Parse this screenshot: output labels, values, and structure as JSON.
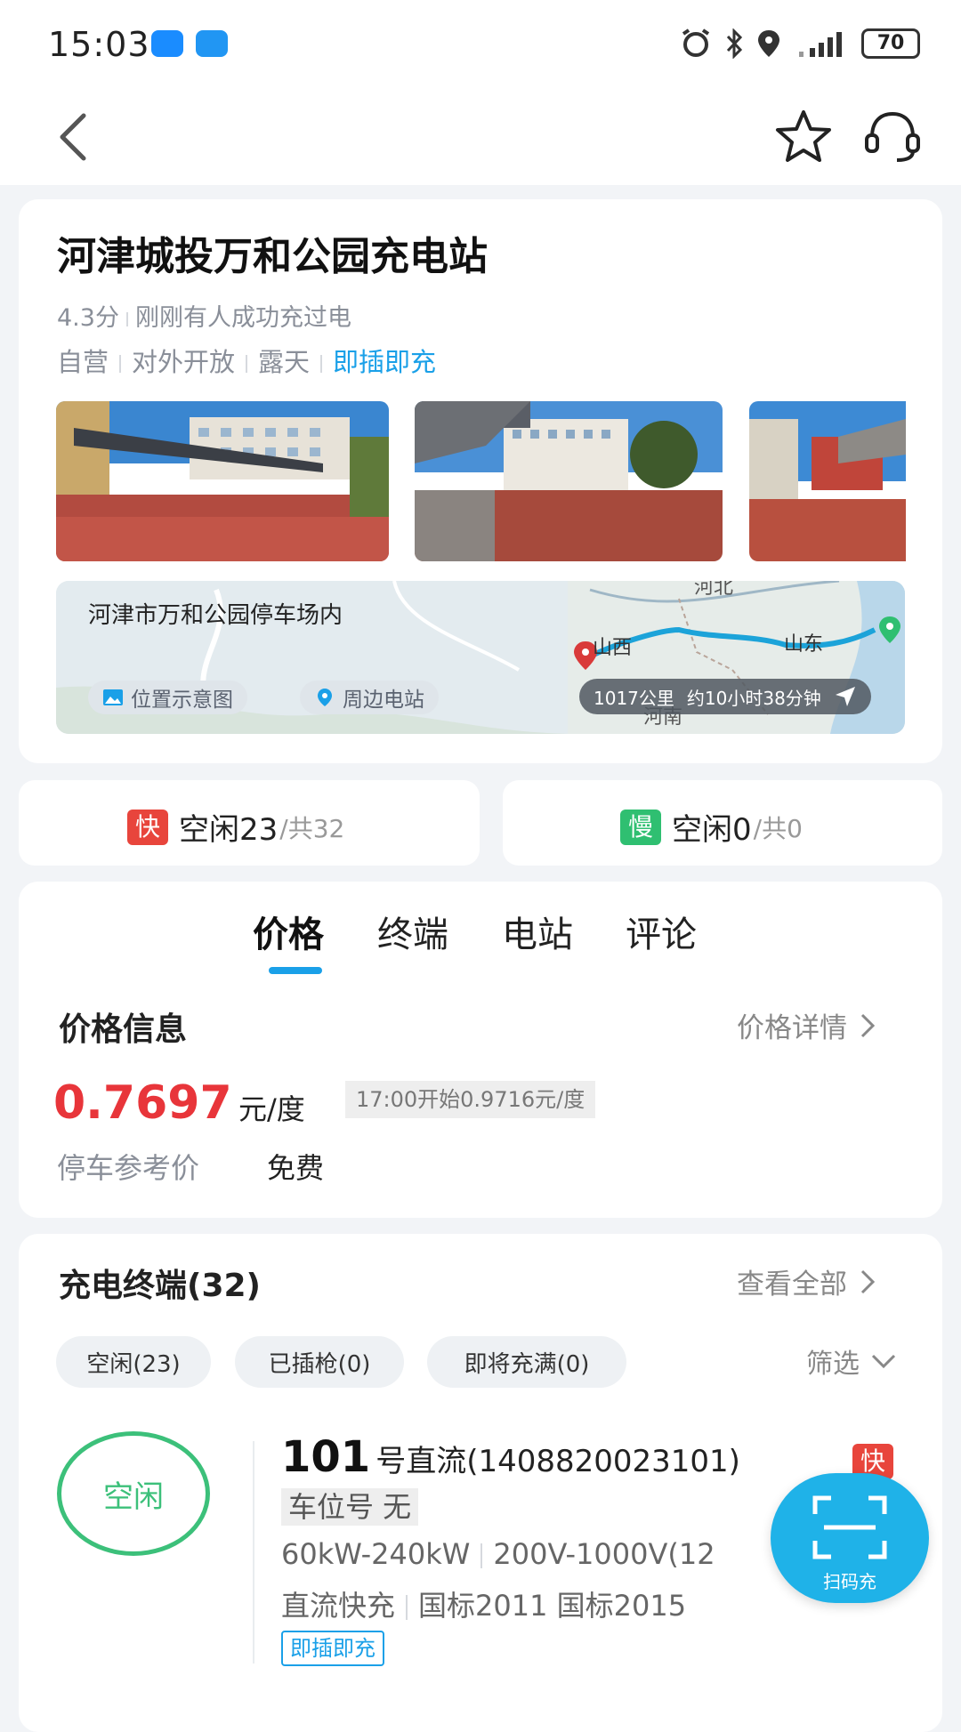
{
  "status_bar": {
    "time": "15:03",
    "battery": "70"
  },
  "station": {
    "name": "河津城投万和公园充电站",
    "rating": "4.3分",
    "recent": "刚刚有人成功充过电",
    "tags": [
      "自营",
      "对外开放",
      "露天"
    ],
    "highlight_tag": "即插即充",
    "address": "河津市万和公园停车场内",
    "location_btn": "位置示意图",
    "nearby_btn": "周边电站",
    "route": {
      "distance": "1017公里",
      "duration": "约10小时38分钟",
      "map_labels": [
        "河北",
        "山西",
        "山东",
        "河南"
      ]
    }
  },
  "availability": {
    "fast": {
      "tag": "快",
      "label": "空闲23",
      "total": "/共32"
    },
    "slow": {
      "tag": "慢",
      "label": "空闲0",
      "total": "/共0"
    }
  },
  "tabs": [
    "价格",
    "终端",
    "电站",
    "评论"
  ],
  "price": {
    "heading": "价格信息",
    "detail_link": "价格详情",
    "value": "0.7697",
    "unit": "元/度",
    "next_price": "17:00开始0.9716元/度",
    "parking_label": "停车参考价",
    "parking_value": "免费"
  },
  "terminals": {
    "heading": "充电终端(32)",
    "view_all": "查看全部",
    "filters": [
      "空闲(23)",
      "已插枪(0)",
      "即将充满(0)"
    ],
    "filter_dropdown": "筛选",
    "item": {
      "status": "空闲",
      "number": "101",
      "name": "号直流(1408820023101)",
      "speed_tag": "快",
      "parking_spot": "车位号 无",
      "power": "60kW-240kW",
      "voltage": "200V-1000V(12",
      "type": "直流快充",
      "standards": "国标2011 国标2015",
      "plug_tag": "即插即充"
    }
  },
  "scan_button": {
    "label": "扫码充"
  },
  "colors": {
    "accent": "#1aa0e8",
    "price_red": "#e8353a",
    "fast_red": "#e8453c",
    "slow_green": "#2fbf71",
    "idle_green": "#3cc07a"
  }
}
